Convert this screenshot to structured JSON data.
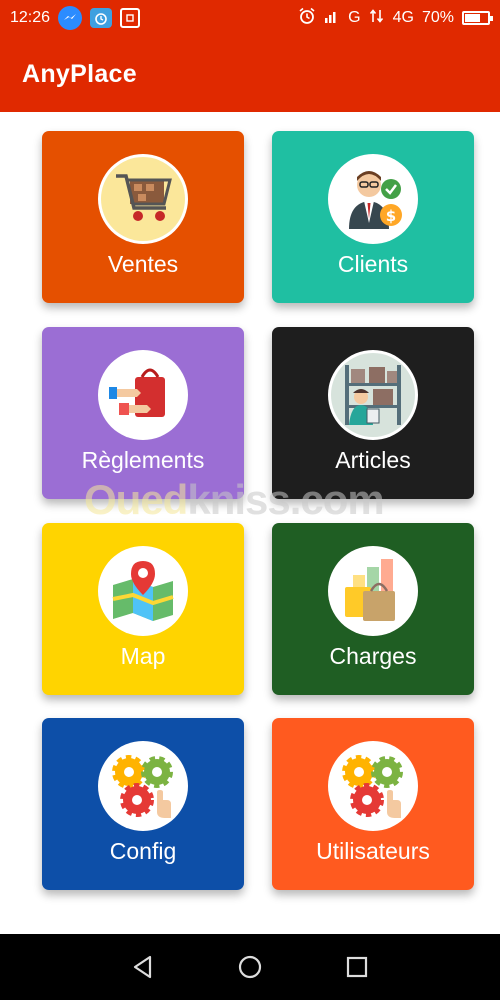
{
  "status_bar": {
    "time": "12:26",
    "network_left": "G",
    "network_right": "4G",
    "battery_text": "70%",
    "battery_level": 0.7,
    "icons": [
      "messenger-icon",
      "alarm-clock-app-icon",
      "screenshot-icon",
      "alarm-icon",
      "signal-icon",
      "data-arrows-icon",
      "battery-icon"
    ]
  },
  "app_bar": {
    "title": "AnyPlace"
  },
  "tiles": [
    {
      "label": "Ventes",
      "color": "#e55000",
      "icon": "shopping-cart-icon"
    },
    {
      "label": "Clients",
      "color": "#1fbfa2",
      "icon": "businessman-icon"
    },
    {
      "label": "Règlements",
      "color": "#9b6ed4",
      "icon": "payment-bag-icon"
    },
    {
      "label": "Articles",
      "color": "#1e1e1e",
      "icon": "warehouse-boxes-icon"
    },
    {
      "label": "Map",
      "color": "#ffd400",
      "icon": "map-pin-icon"
    },
    {
      "label": "Charges",
      "color": "#1f5e23",
      "icon": "shopping-bags-chart-icon"
    },
    {
      "label": "Config",
      "color": "#0d4fa8",
      "icon": "gears-icon"
    },
    {
      "label": "Utilisateurs",
      "color": "#ff5a1f",
      "icon": "gears-hand-icon"
    }
  ],
  "watermark": {
    "part1": "Oued",
    "part2": "kniss",
    "part3": ".com"
  },
  "nav_bar": {
    "icons": [
      "back-triangle-icon",
      "home-circle-icon",
      "recent-square-icon"
    ]
  },
  "theme": {
    "primary": "#e02900"
  }
}
